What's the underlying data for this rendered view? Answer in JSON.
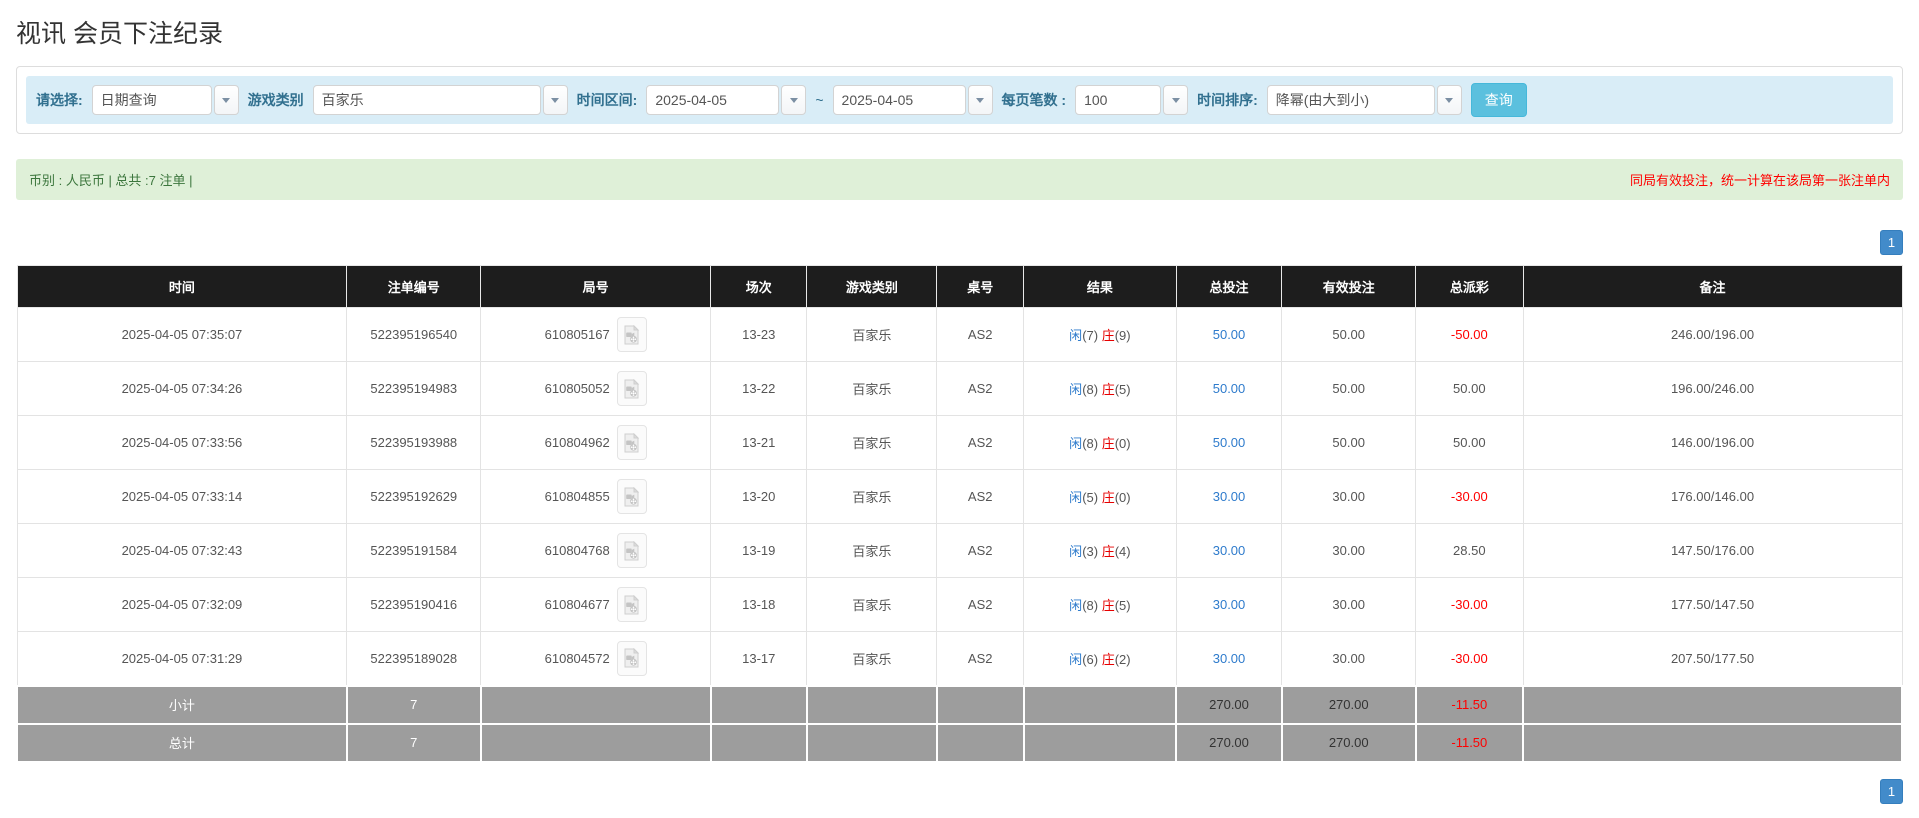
{
  "page": {
    "title": "视讯 会员下注纪录"
  },
  "filters": {
    "select_label": "请选择:",
    "select_value": "日期查询",
    "game_label": "游戏类别",
    "game_value": "百家乐",
    "range_label": "时间区间:",
    "date_from": "2025-04-05",
    "range_separator": "~",
    "date_to": "2025-04-05",
    "page_size_label": "每页笔数 :",
    "page_size_value": "100",
    "sort_label": "时间排序:",
    "sort_value": "降幂(由大到小)",
    "search_button_label": "查询"
  },
  "summary": {
    "left": "币别 : 人民币 | 总共 :7 注单 |",
    "right": "同局有效投注，统一计算在该局第一张注单内"
  },
  "pagination": {
    "current": "1"
  },
  "icons": {
    "caret_down": "caret-down-icon",
    "video": "video-file-icon"
  },
  "colors": {
    "filter_bg": "#d9edf7",
    "filter_label": "#31708f",
    "summary_bg": "#dff0d8",
    "summary_green": "#3c763d",
    "alert_red": "#ff0000",
    "link_blue": "#2e7bcc",
    "banker_red": "#e60000",
    "header_bg": "#1d1d1d",
    "footer_bg": "#9d9d9d",
    "search_btn": "#5bc0de",
    "pager_btn": "#428bca"
  },
  "table": {
    "headers": [
      "时间",
      "注单编号",
      "局号",
      "场次",
      "游戏类别",
      "桌号",
      "结果",
      "总投注",
      "有效投注",
      "总派彩",
      "备注"
    ],
    "rows": [
      {
        "time": "2025-04-05 07:35:07",
        "bet_id": "522395196540",
        "round": "610805167",
        "session": "13-23",
        "game": "百家乐",
        "table_no": "AS2",
        "player_label": "闲",
        "player_score": "(7)",
        "banker_label": "庄",
        "banker_score": "(9)",
        "total_bet": "50.00",
        "valid_bet": "50.00",
        "payout": "-50.00",
        "remark": "246.00/196.00"
      },
      {
        "time": "2025-04-05 07:34:26",
        "bet_id": "522395194983",
        "round": "610805052",
        "session": "13-22",
        "game": "百家乐",
        "table_no": "AS2",
        "player_label": "闲",
        "player_score": "(8)",
        "banker_label": "庄",
        "banker_score": "(5)",
        "total_bet": "50.00",
        "valid_bet": "50.00",
        "payout": "50.00",
        "remark": "196.00/246.00"
      },
      {
        "time": "2025-04-05 07:33:56",
        "bet_id": "522395193988",
        "round": "610804962",
        "session": "13-21",
        "game": "百家乐",
        "table_no": "AS2",
        "player_label": "闲",
        "player_score": "(8)",
        "banker_label": "庄",
        "banker_score": "(0)",
        "total_bet": "50.00",
        "valid_bet": "50.00",
        "payout": "50.00",
        "remark": "146.00/196.00"
      },
      {
        "time": "2025-04-05 07:33:14",
        "bet_id": "522395192629",
        "round": "610804855",
        "session": "13-20",
        "game": "百家乐",
        "table_no": "AS2",
        "player_label": "闲",
        "player_score": "(5)",
        "banker_label": "庄",
        "banker_score": "(0)",
        "total_bet": "30.00",
        "valid_bet": "30.00",
        "payout": "-30.00",
        "remark": "176.00/146.00"
      },
      {
        "time": "2025-04-05 07:32:43",
        "bet_id": "522395191584",
        "round": "610804768",
        "session": "13-19",
        "game": "百家乐",
        "table_no": "AS2",
        "player_label": "闲",
        "player_score": "(3)",
        "banker_label": "庄",
        "banker_score": "(4)",
        "total_bet": "30.00",
        "valid_bet": "30.00",
        "payout": "28.50",
        "remark": "147.50/176.00"
      },
      {
        "time": "2025-04-05 07:32:09",
        "bet_id": "522395190416",
        "round": "610804677",
        "session": "13-18",
        "game": "百家乐",
        "table_no": "AS2",
        "player_label": "闲",
        "player_score": "(8)",
        "banker_label": "庄",
        "banker_score": "(5)",
        "total_bet": "30.00",
        "valid_bet": "30.00",
        "payout": "-30.00",
        "remark": "177.50/147.50"
      },
      {
        "time": "2025-04-05 07:31:29",
        "bet_id": "522395189028",
        "round": "610804572",
        "session": "13-17",
        "game": "百家乐",
        "table_no": "AS2",
        "player_label": "闲",
        "player_score": "(6)",
        "banker_label": "庄",
        "banker_score": "(2)",
        "total_bet": "30.00",
        "valid_bet": "30.00",
        "payout": "-30.00",
        "remark": "207.50/177.50"
      }
    ],
    "footer": [
      {
        "label": "小计",
        "count": "7",
        "total_bet": "270.00",
        "valid_bet": "270.00",
        "payout": "-11.50",
        "remark": ""
      },
      {
        "label": "总计",
        "count": "7",
        "total_bet": "270.00",
        "valid_bet": "270.00",
        "payout": "-11.50",
        "remark": ""
      }
    ]
  }
}
